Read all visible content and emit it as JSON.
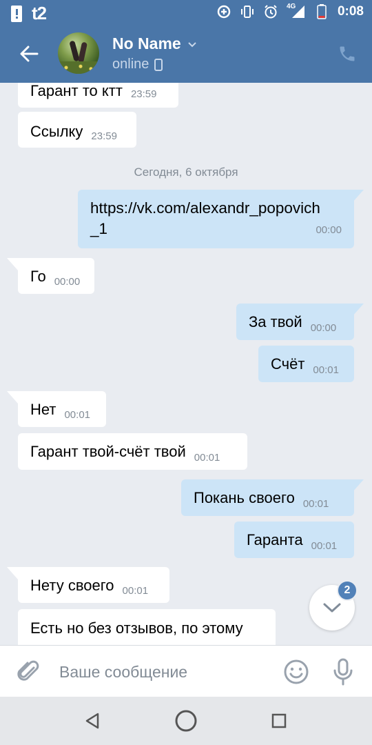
{
  "status_bar": {
    "carrier": "t2",
    "network": "4G",
    "time": "0:08"
  },
  "header": {
    "name": "No Name",
    "status": "online"
  },
  "chat": {
    "date_separator": "Сегодня, 6 октября",
    "messages": [
      {
        "dir": "in",
        "text": "Гарант то ктт",
        "time": "23:59"
      },
      {
        "dir": "in",
        "text": "Ссылку",
        "time": "23:59"
      },
      {
        "dir": "out",
        "text_line1": "https://vk.com/alexandr_popovich",
        "text_line2": "_1",
        "time": "00:00"
      },
      {
        "dir": "in",
        "text": "Го",
        "time": "00:00"
      },
      {
        "dir": "out",
        "text": "За твой",
        "time": "00:00"
      },
      {
        "dir": "out",
        "text": "Счёт",
        "time": "00:01"
      },
      {
        "dir": "in",
        "text": "Нет",
        "time": "00:01"
      },
      {
        "dir": "in",
        "text": "Гарант твой-счёт твой",
        "time": "00:01"
      },
      {
        "dir": "out",
        "text": "Покань своего",
        "time": "00:01"
      },
      {
        "dir": "out",
        "text": "Гаранта",
        "time": "00:01"
      },
      {
        "dir": "in",
        "text": "Нету своего",
        "time": "00:01"
      },
      {
        "dir": "in",
        "text": "Есть но без отзывов, по этому",
        "time": ""
      }
    ],
    "unread_count": "2"
  },
  "composer": {
    "placeholder": "Ваше сообщение"
  },
  "colors": {
    "header_bg": "#4a76a8",
    "chat_bg": "#e9ecf1",
    "outgoing_bubble": "#cce4f7",
    "incoming_bubble": "#ffffff",
    "link": "#2a5885",
    "badge": "#5181b8"
  },
  "icons": {
    "back": "arrow-left-icon",
    "call": "phone-icon",
    "attach": "paperclip-icon",
    "emoji": "smile-icon",
    "voice": "microphone-icon",
    "scroll": "chevron-down-icon"
  }
}
